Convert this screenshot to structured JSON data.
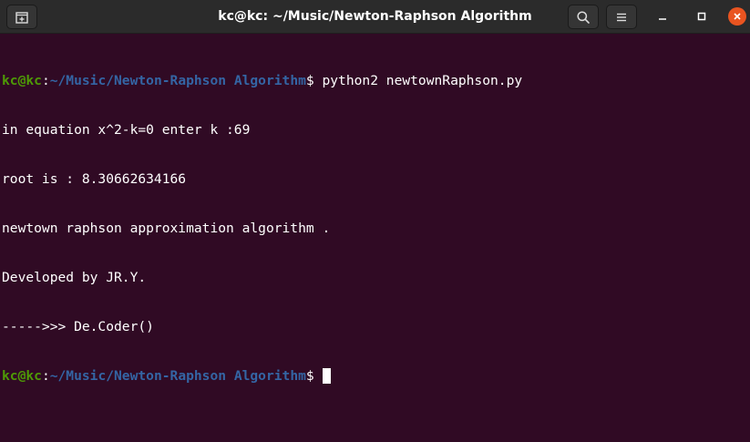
{
  "window": {
    "title": "kc@kc: ~/Music/Newton-Raphson Algorithm"
  },
  "colors": {
    "terminal_bg": "#300a24",
    "prompt_user": "#4e9a06",
    "prompt_path": "#3465a4",
    "close_button": "#e95420"
  },
  "icons": {
    "new_tab": "new-tab-icon",
    "search": "search-icon",
    "menu": "hamburger-menu-icon",
    "minimize": "minimize-icon",
    "maximize": "maximize-icon",
    "close": "close-icon"
  },
  "terminal": {
    "prompt1": {
      "user": "kc@kc",
      "colon": ":",
      "path": "~/Music/Newton-Raphson Algorithm",
      "dollar": "$",
      "command": " python2 newtownRaphson.py"
    },
    "output": [
      "in equation x^2-k=0 enter k :69",
      "root is : 8.30662634166",
      "newtown raphson approximation algorithm .",
      "Developed by JR.Y.",
      "----->>> De.Coder()"
    ],
    "prompt2": {
      "user": "kc@kc",
      "colon": ":",
      "path": "~/Music/Newton-Raphson Algorithm",
      "dollar": "$",
      "command": " "
    }
  }
}
